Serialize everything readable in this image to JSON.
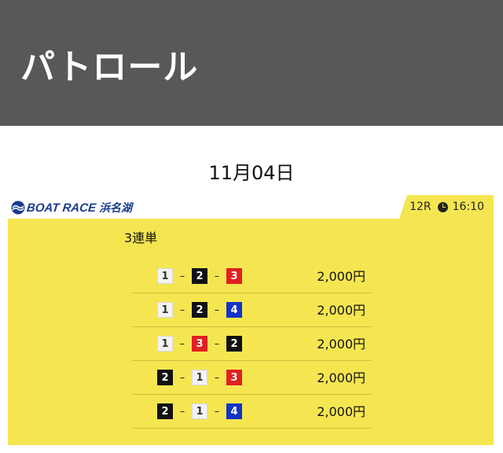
{
  "header": {
    "title": "パトロール"
  },
  "date": "11月04日",
  "logo": {
    "text": "BOAT RACE",
    "venue": "浜名湖"
  },
  "race": {
    "number": "12R",
    "time": "16:10"
  },
  "bet_type": "3連単",
  "colors": {
    "header_bg": "#585858",
    "card_bg": "#f5e651",
    "brand": "#1a3b8f"
  },
  "bets": [
    {
      "combo": [
        1,
        2,
        3
      ],
      "amount": "2,000円"
    },
    {
      "combo": [
        1,
        2,
        4
      ],
      "amount": "2,000円"
    },
    {
      "combo": [
        1,
        3,
        2
      ],
      "amount": "2,000円"
    },
    {
      "combo": [
        2,
        1,
        3
      ],
      "amount": "2,000円"
    },
    {
      "combo": [
        2,
        1,
        4
      ],
      "amount": "2,000円"
    }
  ]
}
